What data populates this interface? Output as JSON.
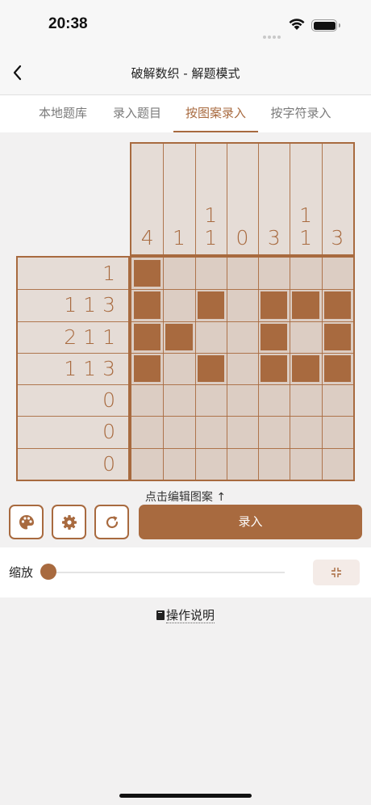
{
  "status_bar": {
    "time": "20:38"
  },
  "nav": {
    "title": "破解数织 - 解题模式"
  },
  "tabs": [
    {
      "label": "本地题库",
      "active": false
    },
    {
      "label": "录入题目",
      "active": false
    },
    {
      "label": "按图案录入",
      "active": true
    },
    {
      "label": "按字符录入",
      "active": false
    }
  ],
  "puzzle": {
    "column_clues": [
      [
        "4"
      ],
      [
        "1"
      ],
      [
        "1",
        "1"
      ],
      [
        "0"
      ],
      [
        "3"
      ],
      [
        "1",
        "1"
      ],
      [
        "3"
      ]
    ],
    "row_clues": [
      "1",
      "113",
      "211",
      "113",
      "0",
      "0",
      "0"
    ],
    "cells": [
      [
        1,
        0,
        0,
        0,
        0,
        0,
        0
      ],
      [
        1,
        0,
        1,
        0,
        1,
        1,
        1
      ],
      [
        1,
        1,
        0,
        0,
        1,
        0,
        1
      ],
      [
        1,
        0,
        1,
        0,
        1,
        1,
        1
      ],
      [
        0,
        0,
        0,
        0,
        0,
        0,
        0
      ],
      [
        0,
        0,
        0,
        0,
        0,
        0,
        0
      ],
      [
        0,
        0,
        0,
        0,
        0,
        0,
        0
      ]
    ]
  },
  "edit_hint": "点击编辑图案 ↑",
  "toolbar": {
    "palette_icon": "palette-icon",
    "settings_icon": "gear-icon",
    "refresh_icon": "refresh-icon",
    "submit_label": "录入"
  },
  "zoom": {
    "label": "缩放",
    "value": 0
  },
  "help": {
    "label": "操作说明"
  },
  "colors": {
    "accent": "#a86a3f",
    "clue_bg": "#e5dcd6",
    "cell_bg": "#dccdc3"
  }
}
